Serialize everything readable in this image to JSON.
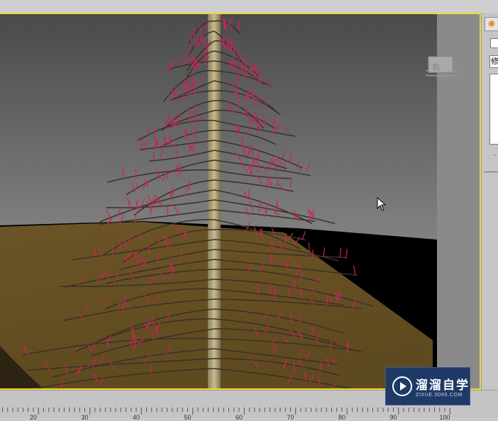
{
  "viewport": {
    "label": "3D perspective viewport",
    "viewcube_label": "右",
    "accent_border_color": "#f0d82a"
  },
  "panel": {
    "tab_icon": "sun-icon",
    "field_text": "修"
  },
  "ruler": {
    "ticks": [
      "20",
      "30",
      "40",
      "50",
      "60",
      "70",
      "80",
      "90",
      "100"
    ]
  },
  "watermark": {
    "title": "溜溜自学",
    "subtitle": "ZIXUE.3D66.COM"
  }
}
